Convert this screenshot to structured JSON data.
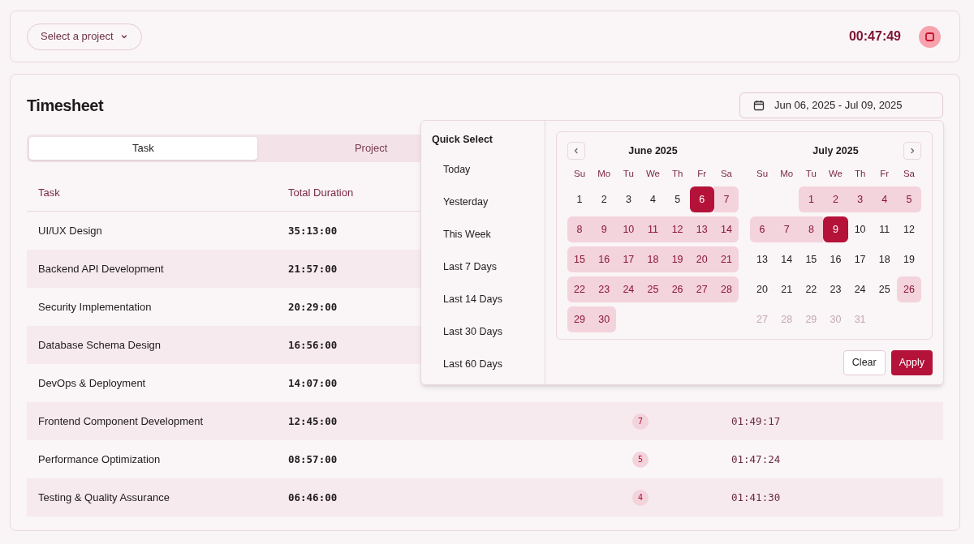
{
  "top_bar": {
    "project_select": {
      "placeholder": "Select a project"
    },
    "timer": "00:47:49",
    "timer_running": true
  },
  "timesheet": {
    "title": "Timesheet",
    "date_range": "Jun 06, 2025 - Jul 09, 2025",
    "tabs": [
      {
        "label": "Task",
        "selected": true
      },
      {
        "label": "Project",
        "selected": false
      }
    ],
    "table": {
      "columns": [
        "Task",
        "Total Duration"
      ],
      "rows": [
        {
          "task": "UI/UX Design",
          "duration": "35:13:00"
        },
        {
          "task": "Backend API Development",
          "duration": "21:57:00"
        },
        {
          "task": "Security Implementation",
          "duration": "20:29:00"
        },
        {
          "task": "Database Schema Design",
          "duration": "16:56:00"
        },
        {
          "task": "DevOps & Deployment",
          "duration": "14:07:00"
        },
        {
          "task": "Frontend Component Development",
          "duration": "12:45:00",
          "count": "7",
          "average": "01:49:17"
        },
        {
          "task": "Performance Optimization",
          "duration": "08:57:00",
          "count": "5",
          "average": "01:47:24"
        },
        {
          "task": "Testing & Quality Assurance",
          "duration": "06:46:00",
          "count": "4",
          "average": "01:41:30"
        }
      ]
    }
  },
  "date_picker": {
    "quick_select": {
      "title": "Quick Select",
      "items": [
        "Today",
        "Yesterday",
        "This Week",
        "Last 7 Days",
        "Last 14 Days",
        "Last 30 Days",
        "Last 60 Days"
      ]
    },
    "months": [
      {
        "title": "June 2025",
        "weekdays": [
          "Su",
          "Mo",
          "Tu",
          "We",
          "Th",
          "Fr",
          "Sa"
        ],
        "weeks": [
          [
            {
              "label": "1",
              "selected": false,
              "in_range": false,
              "disabled": false
            },
            {
              "label": "2",
              "selected": false,
              "in_range": false,
              "disabled": false
            },
            {
              "label": "3",
              "selected": false,
              "in_range": false,
              "disabled": false
            },
            {
              "label": "4",
              "selected": false,
              "in_range": false,
              "disabled": false
            },
            {
              "label": "5",
              "selected": false,
              "in_range": false,
              "disabled": false
            },
            {
              "label": "6",
              "selected": true,
              "in_range": true,
              "disabled": false
            },
            {
              "label": "7",
              "selected": false,
              "in_range": true,
              "disabled": false
            }
          ],
          [
            {
              "label": "8",
              "selected": false,
              "in_range": true,
              "disabled": false
            },
            {
              "label": "9",
              "selected": false,
              "in_range": true,
              "disabled": false
            },
            {
              "label": "10",
              "selected": false,
              "in_range": true,
              "disabled": false
            },
            {
              "label": "11",
              "selected": false,
              "in_range": true,
              "disabled": false
            },
            {
              "label": "12",
              "selected": false,
              "in_range": true,
              "disabled": false
            },
            {
              "label": "13",
              "selected": false,
              "in_range": true,
              "disabled": false
            },
            {
              "label": "14",
              "selected": false,
              "in_range": true,
              "disabled": false
            }
          ],
          [
            {
              "label": "15",
              "selected": false,
              "in_range": true,
              "disabled": false
            },
            {
              "label": "16",
              "selected": false,
              "in_range": true,
              "disabled": false
            },
            {
              "label": "17",
              "selected": false,
              "in_range": true,
              "disabled": false
            },
            {
              "label": "18",
              "selected": false,
              "in_range": true,
              "disabled": false
            },
            {
              "label": "19",
              "selected": false,
              "in_range": true,
              "disabled": false
            },
            {
              "label": "20",
              "selected": false,
              "in_range": true,
              "disabled": false
            },
            {
              "label": "21",
              "selected": false,
              "in_range": true,
              "disabled": false
            }
          ],
          [
            {
              "label": "22",
              "selected": false,
              "in_range": true,
              "disabled": false
            },
            {
              "label": "23",
              "selected": false,
              "in_range": true,
              "disabled": false
            },
            {
              "label": "24",
              "selected": false,
              "in_range": true,
              "disabled": false
            },
            {
              "label": "25",
              "selected": false,
              "in_range": true,
              "disabled": false
            },
            {
              "label": "26",
              "selected": false,
              "in_range": true,
              "disabled": false
            },
            {
              "label": "27",
              "selected": false,
              "in_range": true,
              "disabled": false
            },
            {
              "label": "28",
              "selected": false,
              "in_range": true,
              "disabled": false
            }
          ],
          [
            {
              "label": "29",
              "selected": false,
              "in_range": true,
              "disabled": false
            },
            {
              "label": "30",
              "selected": false,
              "in_range": true,
              "disabled": false
            }
          ]
        ]
      },
      {
        "title": "July 2025",
        "weekdays": [
          "Su",
          "Mo",
          "Tu",
          "We",
          "Th",
          "Fr",
          "Sa"
        ],
        "weeks": [
          [
            {
              "label": "1",
              "selected": false,
              "in_range": true,
              "disabled": false
            },
            {
              "label": "2",
              "selected": false,
              "in_range": true,
              "disabled": false
            },
            {
              "label": "3",
              "selected": false,
              "in_range": true,
              "disabled": false
            },
            {
              "label": "4",
              "selected": false,
              "in_range": true,
              "disabled": false
            },
            {
              "label": "5",
              "selected": false,
              "in_range": true,
              "disabled": false
            }
          ],
          [
            {
              "label": "6",
              "selected": false,
              "in_range": true,
              "disabled": false
            },
            {
              "label": "7",
              "selected": false,
              "in_range": true,
              "disabled": false
            },
            {
              "label": "8",
              "selected": false,
              "in_range": true,
              "disabled": false
            },
            {
              "label": "9",
              "selected": true,
              "in_range": true,
              "disabled": false
            },
            {
              "label": "10",
              "selected": false,
              "in_range": false,
              "disabled": false
            },
            {
              "label": "11",
              "selected": false,
              "in_range": false,
              "disabled": false
            },
            {
              "label": "12",
              "selected": false,
              "in_range": false,
              "disabled": false
            }
          ],
          [
            {
              "label": "13",
              "selected": false,
              "in_range": false,
              "disabled": false
            },
            {
              "label": "14",
              "selected": false,
              "in_range": false,
              "disabled": false
            },
            {
              "label": "15",
              "selected": false,
              "in_range": false,
              "disabled": false
            },
            {
              "label": "16",
              "selected": false,
              "in_range": false,
              "disabled": false
            },
            {
              "label": "17",
              "selected": false,
              "in_range": false,
              "disabled": false
            },
            {
              "label": "18",
              "selected": false,
              "in_range": false,
              "disabled": false
            },
            {
              "label": "19",
              "selected": false,
              "in_range": false,
              "disabled": false
            }
          ],
          [
            {
              "label": "20",
              "selected": false,
              "in_range": false,
              "disabled": false
            },
            {
              "label": "21",
              "selected": false,
              "in_range": false,
              "disabled": false
            },
            {
              "label": "22",
              "selected": false,
              "in_range": false,
              "disabled": false
            },
            {
              "label": "23",
              "selected": false,
              "in_range": false,
              "disabled": false
            },
            {
              "label": "24",
              "selected": false,
              "in_range": false,
              "disabled": false
            },
            {
              "label": "25",
              "selected": false,
              "in_range": false,
              "disabled": false
            },
            {
              "label": "26",
              "selected": false,
              "in_range": true,
              "disabled": false
            }
          ],
          [
            {
              "label": "27",
              "selected": false,
              "in_range": false,
              "disabled": true
            },
            {
              "label": "28",
              "selected": false,
              "in_range": false,
              "disabled": true
            },
            {
              "label": "29",
              "selected": false,
              "in_range": false,
              "disabled": true
            },
            {
              "label": "30",
              "selected": false,
              "in_range": false,
              "disabled": true
            },
            {
              "label": "31",
              "selected": false,
              "in_range": false,
              "disabled": true
            }
          ]
        ]
      }
    ],
    "buttons": [
      "Clear",
      "Apply"
    ]
  }
}
